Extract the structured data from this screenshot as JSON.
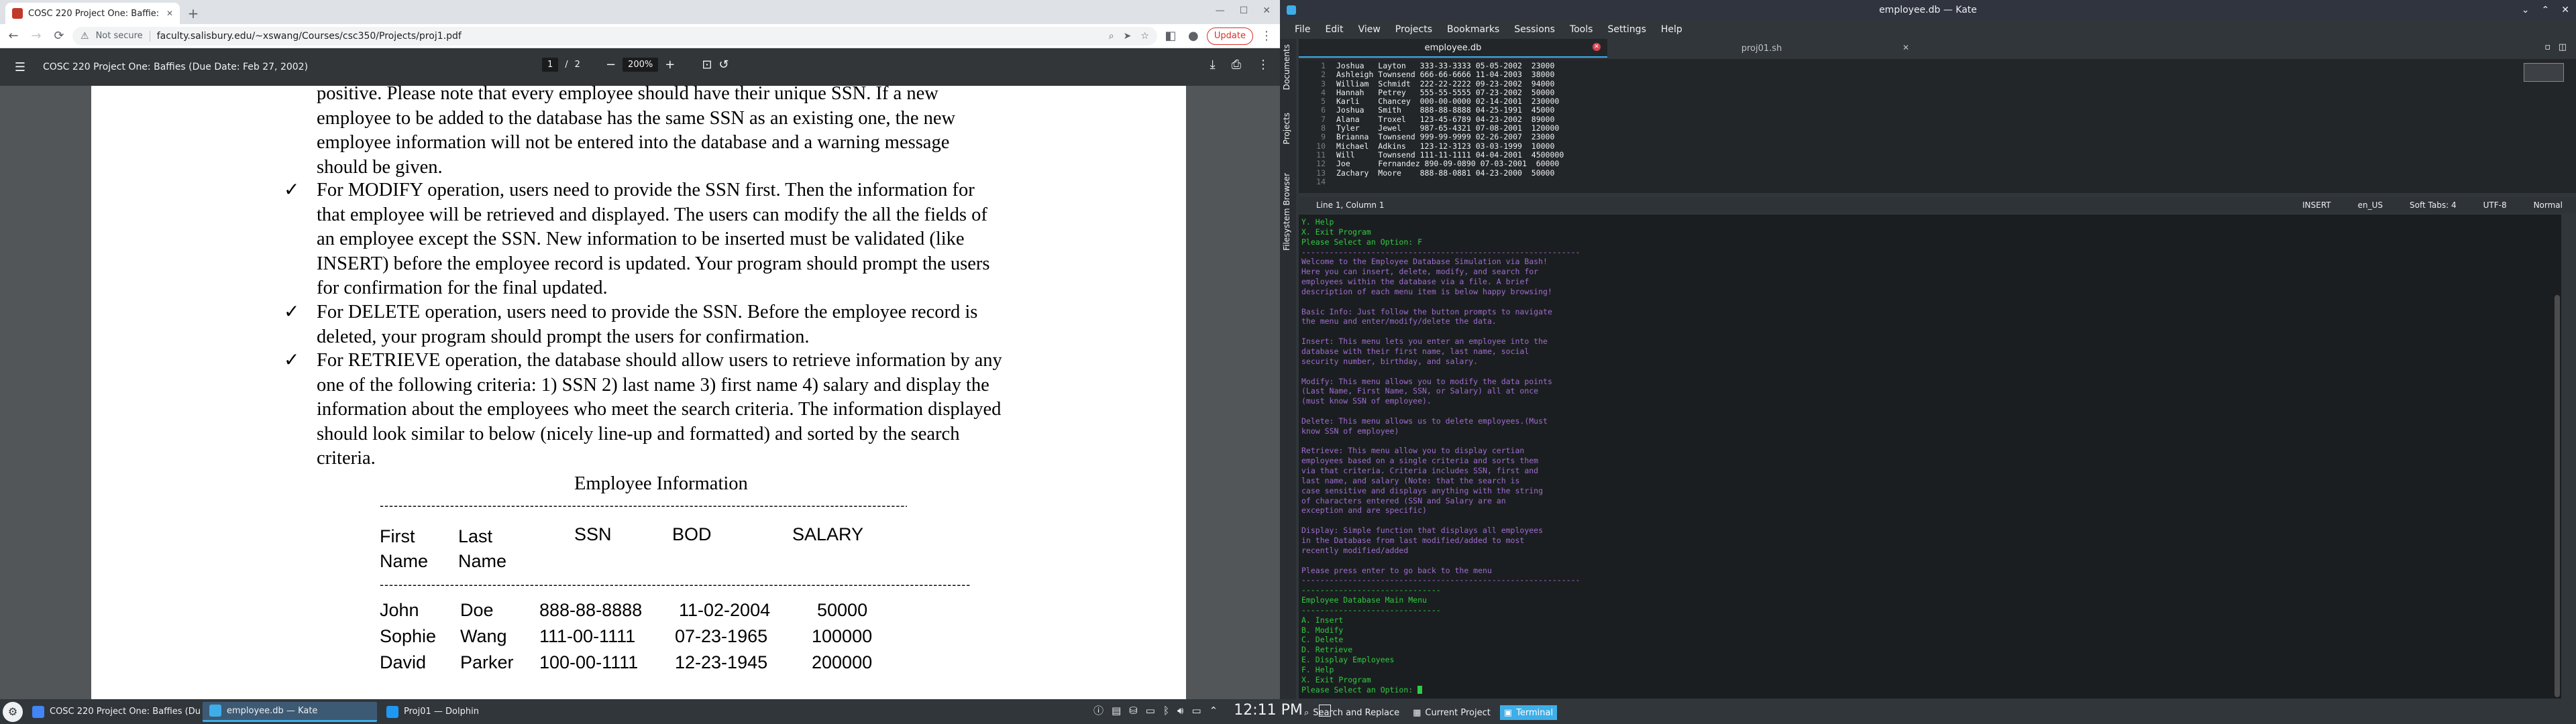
{
  "browser": {
    "tab_title": "COSC 220 Project One: Baffie:",
    "new_tab": "+",
    "url_secure": "Not secure",
    "url": "faculty.salisbury.edu/~xswang/Courses/csc350/Projects/proj1.pdf",
    "update_label": "Update"
  },
  "pdf": {
    "title": "COSC 220 Project One: Baffies (Due Date: Feb 27, 2002)",
    "page_current": "1",
    "page_sep": "/",
    "page_total": "2",
    "zoom": "200%",
    "lines": [
      "positive. Please note that every employee should have their unique SSN.  If a new",
      "employee to be added to the database has the same SSN as an existing one, the new",
      "employee information will not be entered into the database and a warning message",
      "should be given."
    ],
    "bullets": [
      {
        "lines": [
          "For MODIFY operation, users need to provide the SSN first. Then the information for",
          "that employee will be retrieved and displayed. The users can modify the all the fields of",
          "an employee except the SSN. New information to be inserted must be validated (like",
          "INSERT) before the employee record is updated. Your program should prompt the users",
          "for confirmation for the final updated."
        ]
      },
      {
        "lines": [
          "For DELETE operation, users need to provide the SSN. Before the employee record is",
          "deleted, your program should prompt the users for confirmation."
        ]
      },
      {
        "lines": [
          "For RETRIEVE operation, the database should allow users to retrieve information by any",
          "one of the following criteria: 1) SSN 2) last name 3) first name 4) salary and display the",
          "information about the employees who meet the search criteria. The information displayed",
          "should look similar to below (nicely line-up and formatted) and sorted by the search",
          "criteria."
        ]
      }
    ],
    "table_title": "Employee Information",
    "table_headers": [
      "First\nName",
      "Last\nName",
      "SSN",
      "BOD",
      "SALARY"
    ],
    "table_rows": [
      [
        "John",
        "Doe",
        "888-88-8888",
        "11-02-2004",
        "50000"
      ],
      [
        "Sophie",
        "Wang",
        "111-00-1111",
        "07-23-1965",
        "100000"
      ],
      [
        "David",
        "Parker",
        "100-00-1111",
        "12-23-1945",
        "200000"
      ]
    ]
  },
  "taskbar": {
    "tasks": [
      "COSC 220 Project One: Baffies (Du...",
      "employee.db — Kate",
      "Proj01 — Dolphin"
    ],
    "clock": "12:11 PM"
  },
  "kate": {
    "window_title": "employee.db — Kate",
    "menu": [
      "File",
      "Edit",
      "View",
      "Projects",
      "Bookmarks",
      "Sessions",
      "Tools",
      "Settings",
      "Help"
    ],
    "side_tabs": [
      "Documents",
      "Projects",
      "Filesystem Browser"
    ],
    "doc_tabs": [
      "employee.db",
      "proj01.sh"
    ],
    "line_numbers": [
      "1",
      "2",
      "3",
      "4",
      "5",
      "6",
      "7",
      "8",
      "9",
      "10",
      "11",
      "12",
      "13",
      "14"
    ],
    "code_lines": [
      "Joshua   Layton   333-33-3333 05-05-2002  23000",
      "Ashleigh Townsend 666-66-6666 11-04-2003  38000",
      "William  Schmidt  222-22-2222 09-23-2002  94000",
      "Hannah   Petrey   555-55-5555 07-23-2002  50000",
      "Karli    Chancey  000-00-0000 02-14-2001  230000",
      "Joshua   Smith    888-88-8888 04-25-1991  45000",
      "Alana    Troxel   123-45-6789 04-23-2002  89000",
      "Tyler    Jewel    987-65-4321 07-08-2001  120000",
      "Brianna  Townsend 999-99-9999 02-26-2007  23000",
      "Michael  Adkins   123-12-3123 03-03-1999  10000",
      "Will     Townsend 111-11-1111 04-04-2001  4500000",
      "Joe      Fernandez 890-09-0890 07-03-2001  60000",
      "Zachary  Moore    888-88-0881 04-23-2000  50000",
      ""
    ],
    "status_pos": "Line 1, Column 1",
    "status_right": [
      "INSERT",
      "en_US",
      "Soft Tabs: 4",
      "UTF-8",
      "Normal"
    ],
    "terminal_lines": [
      {
        "c": "g",
        "t": "Y. Help"
      },
      {
        "c": "g",
        "t": "X. Exit Program"
      },
      {
        "c": "g",
        "t": "Please Select an Option: F"
      },
      {
        "c": "m",
        "t": "------------------------------------------------------------"
      },
      {
        "c": "m",
        "t": "Welcome to the Employee Database Simulation via Bash!"
      },
      {
        "c": "m",
        "t": "Here you can insert, delete, modify, and search for"
      },
      {
        "c": "m",
        "t": "employees within the database via a file. A brief"
      },
      {
        "c": "m",
        "t": "description of each menu item is below happy browsing!"
      },
      {
        "c": "m",
        "t": ""
      },
      {
        "c": "m",
        "t": "Basic Info: Just follow the button prompts to navigate"
      },
      {
        "c": "m",
        "t": "the menu and enter/modify/delete the data."
      },
      {
        "c": "m",
        "t": ""
      },
      {
        "c": "m",
        "t": "Insert: This menu lets you enter an employee into the"
      },
      {
        "c": "m",
        "t": "database with their first name, last name, social"
      },
      {
        "c": "m",
        "t": "security number, birthday, and salary."
      },
      {
        "c": "m",
        "t": ""
      },
      {
        "c": "m",
        "t": "Modify: This menu allows you to modify the data points"
      },
      {
        "c": "m",
        "t": "(Last Name, First Name, SSN, or Salary) all at once"
      },
      {
        "c": "m",
        "t": "(must know SSN of employee)."
      },
      {
        "c": "m",
        "t": ""
      },
      {
        "c": "m",
        "t": "Delete: This menu allows us to delete employees.(Must"
      },
      {
        "c": "m",
        "t": "know SSN of employee)"
      },
      {
        "c": "m",
        "t": ""
      },
      {
        "c": "m",
        "t": "Retrieve: This menu allow you to display certian"
      },
      {
        "c": "m",
        "t": "employees based on a single criteria and sorts them"
      },
      {
        "c": "m",
        "t": "via that criteria. Criteria includes SSN, first and"
      },
      {
        "c": "m",
        "t": "last name, and salary (Note: that the search is"
      },
      {
        "c": "m",
        "t": "case sensitive and displays anything with the string"
      },
      {
        "c": "m",
        "t": "of characters entered (SSN and Salary are an"
      },
      {
        "c": "m",
        "t": "exception and are specific)"
      },
      {
        "c": "m",
        "t": ""
      },
      {
        "c": "m",
        "t": "Display: Simple function that displays all employees"
      },
      {
        "c": "m",
        "t": "in the Database from last modified/added to most"
      },
      {
        "c": "m",
        "t": "recently modified/added"
      },
      {
        "c": "m",
        "t": ""
      },
      {
        "c": "m",
        "t": "Please press enter to go back to the menu"
      },
      {
        "c": "m",
        "t": "------------------------------------------------------------"
      },
      {
        "c": "g",
        "t": "------------------------------"
      },
      {
        "c": "g",
        "t": "Employee Database Main Menu"
      },
      {
        "c": "g",
        "t": "------------------------------"
      },
      {
        "c": "g",
        "t": "A. Insert"
      },
      {
        "c": "g",
        "t": "B. Modify"
      },
      {
        "c": "g",
        "t": "C. Delete"
      },
      {
        "c": "g",
        "t": "D. Retrieve"
      },
      {
        "c": "g",
        "t": "E. Display Employees"
      },
      {
        "c": "g",
        "t": "F. Help"
      },
      {
        "c": "g",
        "t": "X. Exit Program"
      },
      {
        "c": "g",
        "t": "Please Select an Option: "
      }
    ],
    "bottom_tabs": [
      "Search and Replace",
      "Current Project",
      "Terminal"
    ]
  }
}
